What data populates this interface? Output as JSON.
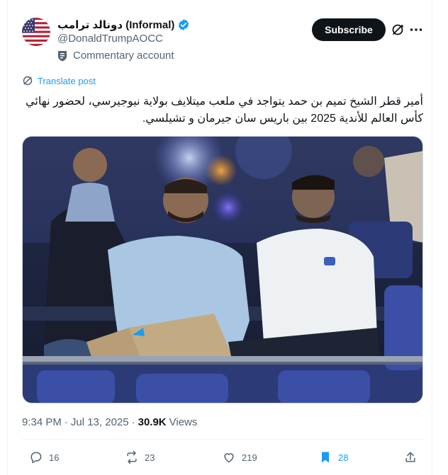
{
  "author": {
    "display_name": "دونالد ترامب (Informal)",
    "handle": "@DonaldTrumpAOCC",
    "account_label": "Commentary account",
    "verified": true
  },
  "header": {
    "subscribe_label": "Subscribe"
  },
  "post": {
    "translate_label": "Translate post",
    "text": "أمير قطر الشيخ تميم بن حمد يتواجد في ملعب ميتلايف بولاية نيوجيرسي، لحضور نهائي كأس العالم للأندية 2025 بين باريس سان جيرمان و تشيلسي.",
    "time": "9:34 PM",
    "date": "Jul 13, 2025",
    "separator": "·",
    "views_count": "30.9K",
    "views_label": "Views"
  },
  "actions": {
    "replies": "16",
    "reposts": "23",
    "likes": "219",
    "bookmarks": "28"
  },
  "colors": {
    "accent": "#1d9bf0",
    "text": "#0f1419",
    "muted": "#536471"
  }
}
